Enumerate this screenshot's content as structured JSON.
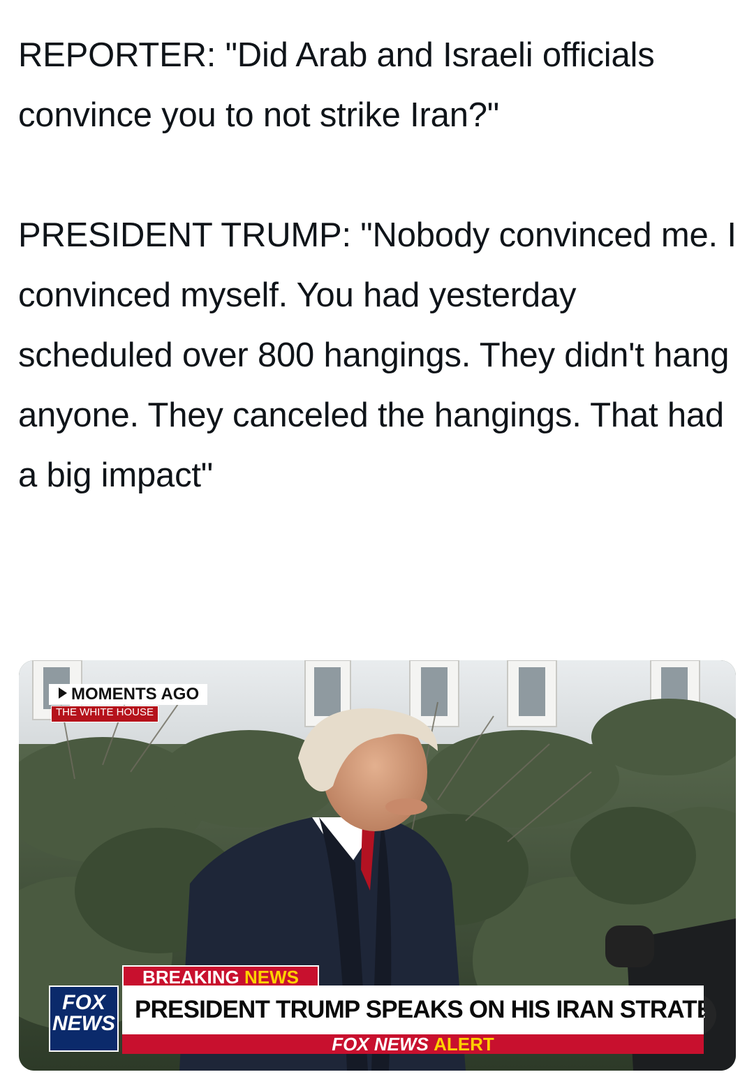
{
  "post": {
    "paragraph_1": "REPORTER: \"Did Arab and Israeli officials convince you to not strike Iran?\"",
    "paragraph_2": "PRESIDENT TRUMP: \"Nobody convinced me. I convinced myself. You had yesterday scheduled over 800 hangings. They didn't hang anyone. They canceled the hangings. That had a big impact\""
  },
  "video": {
    "moments_label": "MOMENTS AGO",
    "location_label": "THE WHITE HOUSE",
    "breaking_word1": "BREAKING",
    "breaking_word2": "NEWS",
    "headline": "PRESIDENT TRUMP SPEAKS ON HIS IRAN STRATEGY",
    "alert_part1": "FOX NEWS",
    "alert_part2": "ALERT",
    "network_logo_line1": "FOX",
    "network_logo_line2": "NEWS",
    "mute_icon": "speaker-muted-icon"
  },
  "colors": {
    "fox_red": "#c8102e",
    "fox_navy": "#0b2a6b",
    "fox_yellow": "#ffd100"
  }
}
